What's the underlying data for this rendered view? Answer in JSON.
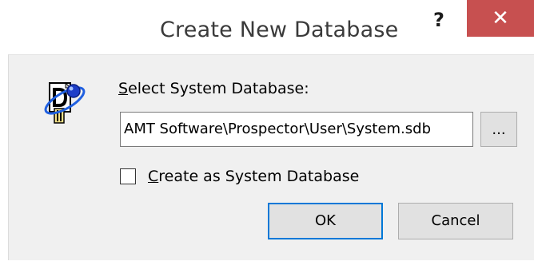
{
  "window": {
    "title": "Create New Database",
    "help_glyph": "?",
    "close_glyph": "✕"
  },
  "dialog": {
    "icon": "database-app-icon",
    "select_label_accel": "S",
    "select_label_rest": "elect System Database:",
    "path_value": "AMT Software\\Prospector\\User\\System.sdb",
    "browse_label": "...",
    "checkbox_checked": false,
    "checkbox_label_accel": "C",
    "checkbox_label_rest": "reate as System Database",
    "ok_label": "OK",
    "cancel_label": "Cancel"
  },
  "colors": {
    "close_button_bg": "#c75050",
    "client_bg": "#f0f0f0",
    "default_button_border": "#0078d7"
  }
}
